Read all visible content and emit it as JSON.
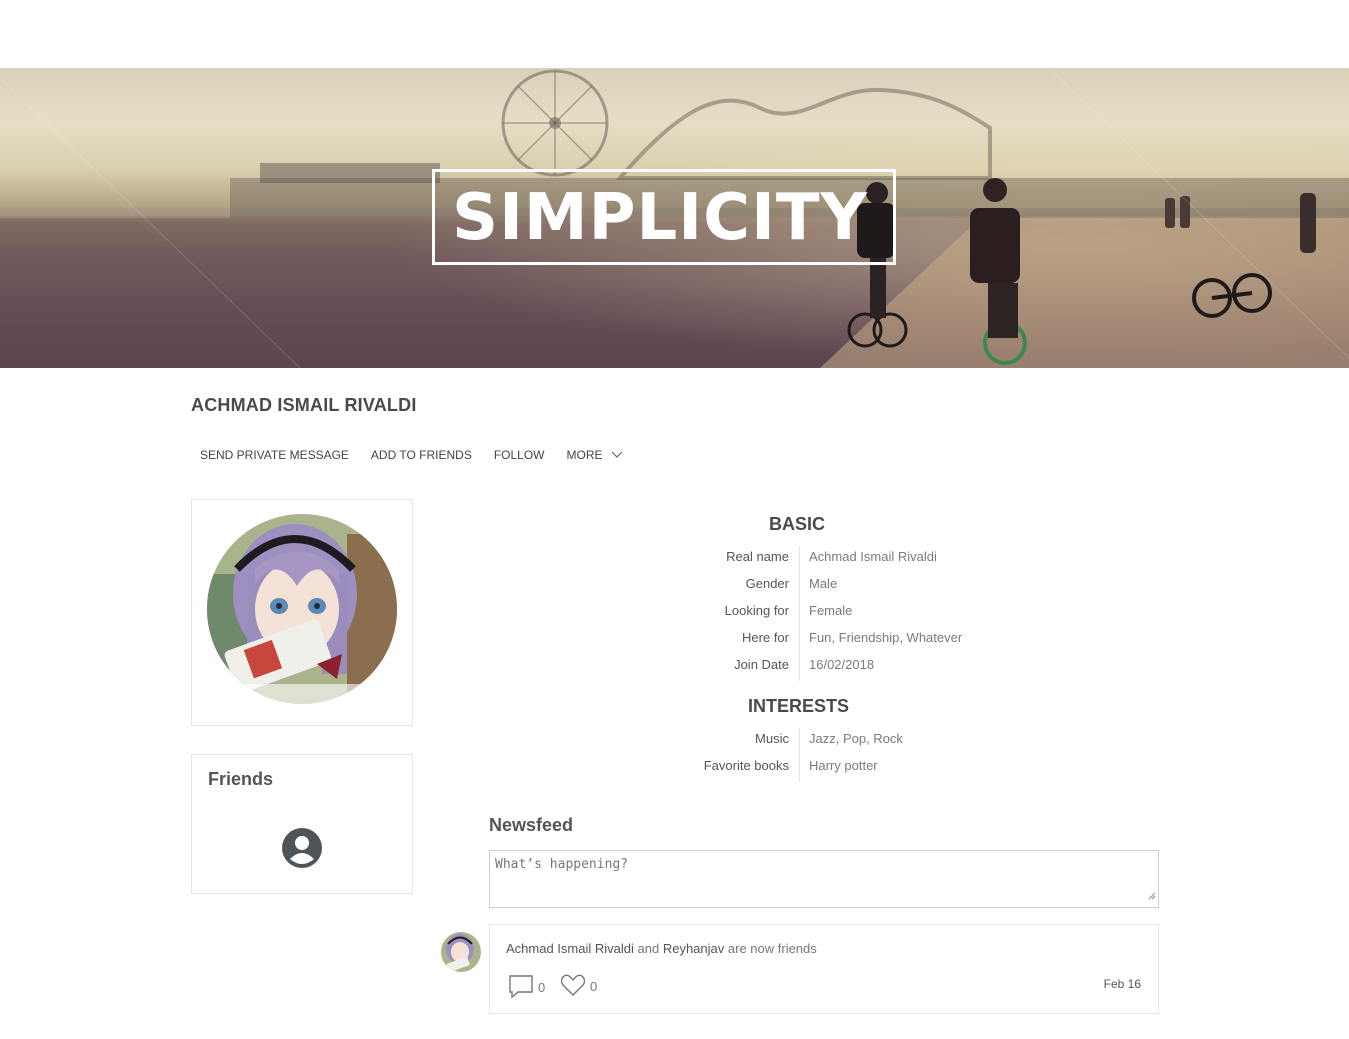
{
  "banner": {
    "logo_text": "SIMPLICITY"
  },
  "profile": {
    "name": "ACHMAD ISMAIL RIVALDI"
  },
  "actions": {
    "send_message": "SEND PRIVATE MESSAGE",
    "add_friend": "ADD TO FRIENDS",
    "follow": "FOLLOW",
    "more": "MORE"
  },
  "friends": {
    "title": "Friends"
  },
  "basic": {
    "title": "BASIC",
    "rows": [
      {
        "label": "Real name",
        "value": "Achmad Ismail Rivaldi"
      },
      {
        "label": "Gender",
        "value": "Male"
      },
      {
        "label": "Looking for",
        "value": "Female"
      },
      {
        "label": "Here for",
        "value": "Fun, Friendship, Whatever"
      },
      {
        "label": "Join Date",
        "value": "16/02/2018"
      }
    ]
  },
  "interests": {
    "title": "INTERESTS",
    "rows": [
      {
        "label": "Music",
        "value": "Jazz, Pop, Rock"
      },
      {
        "label": "Favorite books",
        "value": "Harry potter"
      }
    ]
  },
  "newsfeed": {
    "title": "Newsfeed",
    "composer_placeholder": "What’s happening?",
    "item": {
      "actor": "Achmad Ismail Rivaldi",
      "connector1": "and",
      "target": "Reyhanjav",
      "connector2": "are now friends",
      "comments": "0",
      "likes": "0",
      "date": "Feb 16"
    }
  },
  "colors": {
    "text_dark": "#4a4a4a",
    "text_muted": "#7a7a7a",
    "border": "#e6e6e6"
  }
}
